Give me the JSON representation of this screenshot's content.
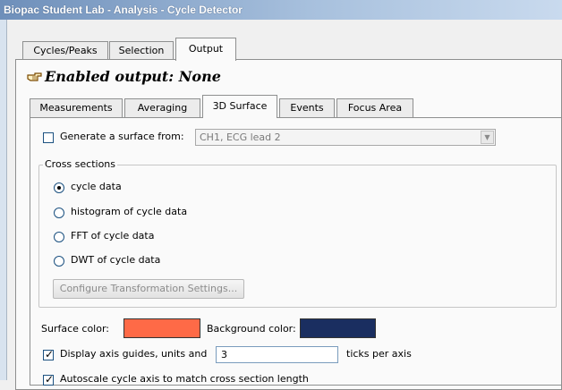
{
  "window": {
    "title": "Biopac Student Lab - Analysis - Cycle Detector"
  },
  "top_tabs": [
    "Cycles/Peaks",
    "Selection",
    "Output"
  ],
  "enabled_output": {
    "label": "Enabled output: None",
    "icon": "pointing-hand-icon"
  },
  "sub_tabs": [
    "Measurements",
    "Averaging",
    "3D Surface",
    "Events",
    "Focus Area"
  ],
  "surface": {
    "generate_label": "Generate a surface from:",
    "generate_checked": false,
    "source_value": "CH1, ECG lead 2"
  },
  "cross_sections": {
    "label": "Cross sections",
    "options": [
      "cycle data",
      "histogram of cycle data",
      "FFT of cycle data",
      "DWT of cycle data"
    ],
    "selected": "cycle data",
    "configure_button": "Configure Transformation Settings..."
  },
  "colors": {
    "surface_label": "Surface color:",
    "surface_color": "#fe6a47",
    "background_label": "Background color:",
    "background_color": "#1a2e60"
  },
  "axis": {
    "display_label": "Display axis guides, units and",
    "display_checked": true,
    "ticks_value": "3",
    "ticks_suffix": "ticks per axis"
  },
  "autoscale": {
    "label": "Autoscale cycle axis to match cross section length",
    "checked": true
  }
}
